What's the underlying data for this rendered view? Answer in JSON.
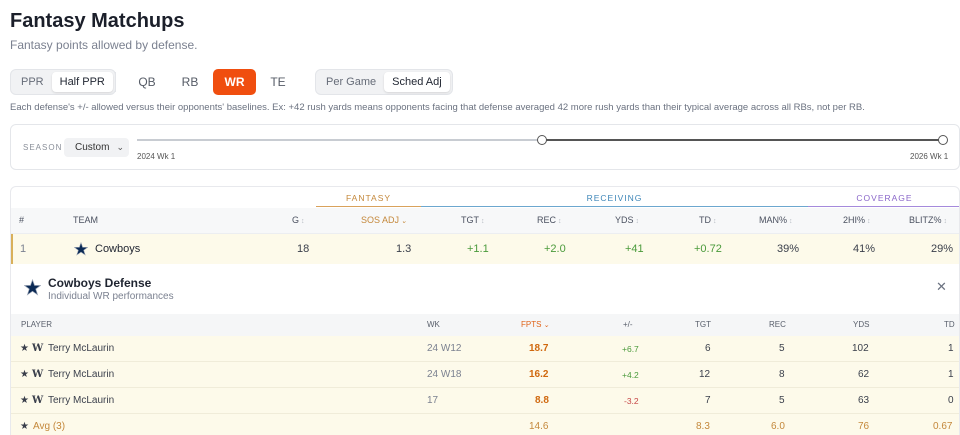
{
  "page": {
    "title": "Fantasy Matchups",
    "subtitle": "Fantasy points allowed by defense."
  },
  "controls": {
    "scoring": [
      "PPR",
      "Half PPR"
    ],
    "scoring_selected": "Half PPR",
    "positions": [
      "QB",
      "RB",
      "WR",
      "TE"
    ],
    "position_selected": "WR",
    "mode": [
      "Per Game",
      "Sched Adj"
    ],
    "mode_selected": "Sched Adj"
  },
  "note": "Each defense's +/- allowed versus their opponents' baselines. Ex: +42 rush yards means opponents facing that defense averaged 42 more rush yards than their typical average across all RBs, not per RB.",
  "season": {
    "label": "SEASON",
    "select_value": "Custom",
    "range_start_label": "2024 Wk 1",
    "range_end_label": "2026 Wk 1"
  },
  "table": {
    "groups": {
      "fantasy": "FANTASY",
      "receiving": "RECEIVING",
      "coverage": "COVERAGE"
    },
    "columns": {
      "rank": "#",
      "team": "TEAM",
      "g": "G",
      "sos_adj": "SOS ADJ",
      "tgt": "TGT",
      "rec": "REC",
      "yds": "YDS",
      "td": "TD",
      "man": "MAN%",
      "twohi": "2HI%",
      "blitz": "BLITZ%"
    },
    "rows": [
      {
        "rank": "1",
        "team": "Cowboys",
        "g": "18",
        "sos_adj": "1.3",
        "tgt": "+1.1",
        "rec": "+2.0",
        "yds": "+41",
        "td": "+0.72",
        "man": "39%",
        "twohi": "41%",
        "blitz": "29%"
      }
    ]
  },
  "detail": {
    "title": "Cowboys Defense",
    "subtitle": "Individual WR performances",
    "close_icon": "close-icon",
    "columns": {
      "player": "PLAYER",
      "wk": "WK",
      "fpts": "FPTS",
      "pm": "+/-",
      "tgt": "TGT",
      "rec": "REC",
      "yds": "YDS",
      "td": "TD"
    },
    "rows": [
      {
        "player": "Terry McLaurin",
        "wk": "24 W12",
        "fpts": "18.7",
        "pm": "+6.7",
        "tgt": "6",
        "rec": "5",
        "yds": "102",
        "td": "1"
      },
      {
        "player": "Terry McLaurin",
        "wk": "24 W18",
        "fpts": "16.2",
        "pm": "+4.2",
        "tgt": "12",
        "rec": "8",
        "yds": "62",
        "td": "1"
      },
      {
        "player": "Terry McLaurin",
        "wk": "17",
        "fpts": "8.8",
        "pm": "-3.2",
        "tgt": "7",
        "rec": "5",
        "yds": "63",
        "td": "0"
      }
    ],
    "avg": {
      "label": "Avg (3)",
      "fpts": "14.6",
      "tgt": "8.3",
      "rec": "6.0",
      "yds": "76",
      "td": "0.67"
    }
  },
  "colors": {
    "accent": "#f04e0f",
    "fantasy": "#c4883b",
    "receiving": "#3e86b8",
    "coverage": "#8a67c9",
    "positive": "#4a9a3b",
    "negative": "#c64545"
  }
}
